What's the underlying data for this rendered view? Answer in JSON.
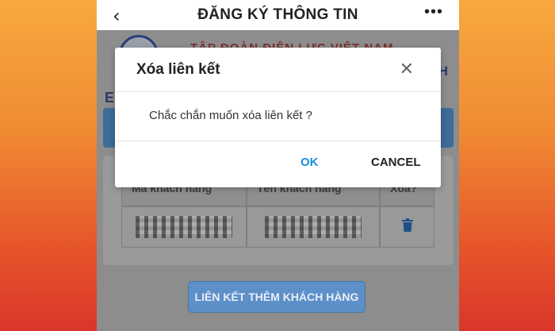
{
  "header": {
    "title": "ĐĂNG KÝ THÔNG TIN",
    "back_icon": "chevron-left-icon",
    "more_icon": "more-horizontal-icon"
  },
  "background": {
    "org_name": "TẬP ĐOÀN ĐIỆN LỰC VIỆT NAM",
    "org_name_fragment": "H",
    "section_fragment": "E",
    "table": {
      "columns": [
        "Mã khách hàng",
        "Tên khách hàng",
        "Xóa?"
      ],
      "delete_icon": "trash-icon"
    },
    "link_button_label": "LIÊN KẾT THÊM KHÁCH HÀNG"
  },
  "dialog": {
    "title": "Xóa liên kết",
    "message": "Chắc chắn muốn xóa liên kết ?",
    "ok_label": "OK",
    "cancel_label": "CANCEL",
    "close_icon": "close-icon"
  },
  "colors": {
    "accent_blue": "#1a8fd8",
    "overlay_gray": "#8d8d8d",
    "bg_gradient_top": "#f7a93f",
    "bg_gradient_bottom": "#d9362a"
  }
}
